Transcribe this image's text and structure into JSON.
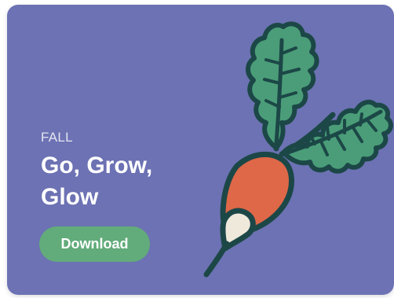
{
  "card": {
    "eyebrow": "FALL",
    "title": "Go, Grow, Glow",
    "button_label": "Download",
    "illustration_icon": "radish-icon"
  },
  "colors": {
    "card_background": "#6c72b3",
    "eyebrow_text": "#e4e4f2",
    "title_text": "#ffffff",
    "button_background": "#62ab7a",
    "button_text": "#ffffff",
    "radish_body": "#de6848",
    "radish_tip": "#efe9dc",
    "leaf_fill": "#4a9d78",
    "outline": "#1c4747"
  }
}
